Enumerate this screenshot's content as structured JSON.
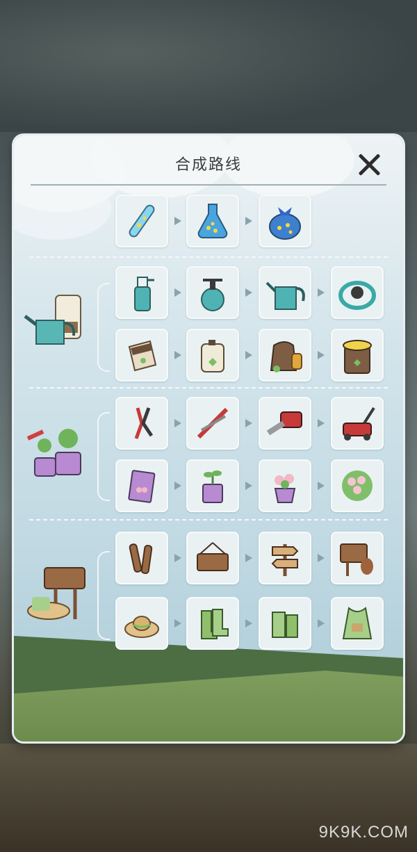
{
  "dialog": {
    "title": "合成路线",
    "close_icon": "close-icon"
  },
  "chains": [
    {
      "category": null,
      "items": [
        "test-tube-stars-icon",
        "flask-stars-icon",
        "bottle-stars-ribbon-icon"
      ]
    },
    {
      "category": "watering-can-fertilizer-icon",
      "items": [
        "spray-bottle-icon",
        "pump-sprayer-icon",
        "watering-can-icon",
        "garden-hose-reel-icon"
      ]
    },
    {
      "category": "watering-can-fertilizer-icon",
      "items": [
        "seed-packet-icon",
        "fertilizer-jug-icon",
        "soil-sack-icon",
        "compost-bin-icon"
      ]
    },
    {
      "category": "pruner-potted-plant-icon",
      "items": [
        "pruning-shears-icon",
        "hedge-shears-icon",
        "chainsaw-icon",
        "lawn-mower-icon"
      ]
    },
    {
      "category": "pruner-potted-plant-icon",
      "items": [
        "flower-seed-packet-icon",
        "sprout-pot-icon",
        "flower-pot-icon",
        "flower-bush-icon"
      ]
    },
    {
      "category": "sign-hat-gloves-icon",
      "items": [
        "stake-labels-icon",
        "hanging-sign-icon",
        "direction-sign-icon",
        "squirrel-sign-icon"
      ]
    },
    {
      "category": "sign-hat-gloves-icon",
      "items": [
        "straw-hat-icon",
        "garden-boots-icon",
        "garden-gloves-icon",
        "garden-apron-icon"
      ]
    }
  ],
  "watermark": "9K9K.COM",
  "colors": {
    "panel_top": "#eef3f5",
    "panel_bottom": "#a9cad6",
    "arrow": "#8aa3aa",
    "grass": "#6b8a4c"
  }
}
